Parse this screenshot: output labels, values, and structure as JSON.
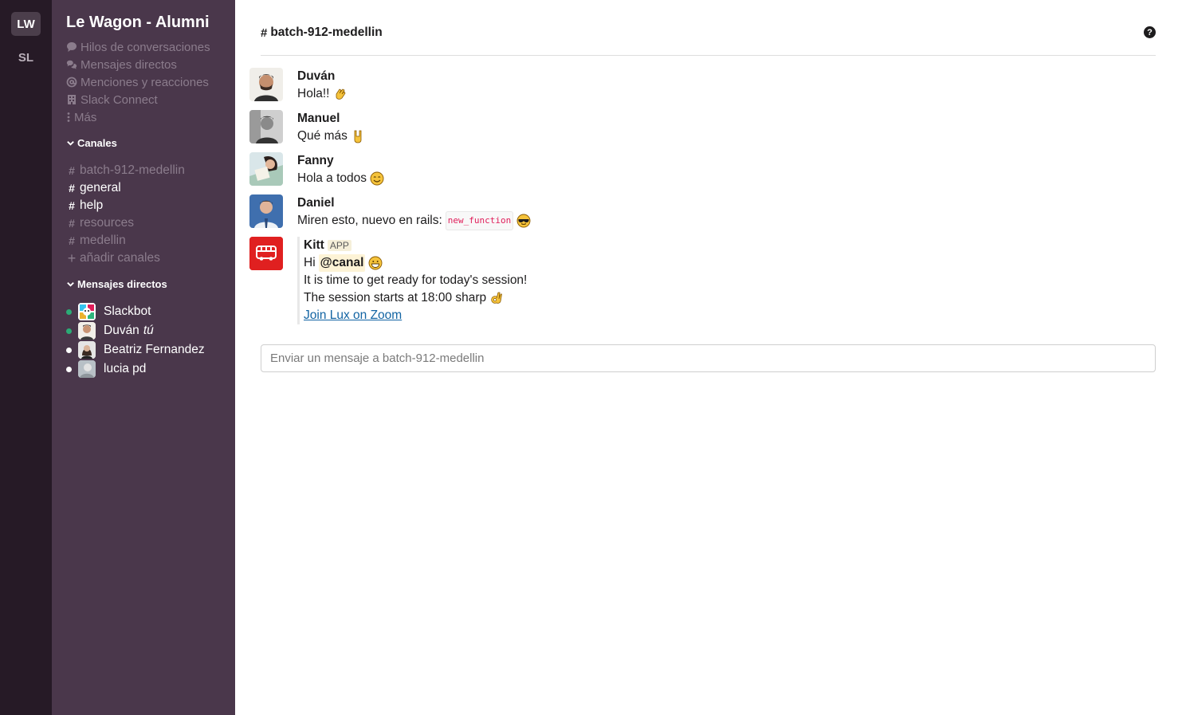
{
  "workspaces": [
    {
      "label": "LW",
      "active": true
    },
    {
      "label": "SL",
      "active": false
    }
  ],
  "sidebar": {
    "team_name": "Le Wagon - Alumni",
    "nav": [
      {
        "label": "Hilos de conversaciones",
        "icon": "threads-icon"
      },
      {
        "label": "Mensajes directos",
        "icon": "direct-messages-icon"
      },
      {
        "label": "Menciones y reacciones",
        "icon": "at-mention-icon"
      },
      {
        "label": "Slack Connect",
        "icon": "building-icon"
      },
      {
        "label": "Más",
        "icon": "more-vertical-icon"
      }
    ],
    "channels_header": "Canales",
    "channels": [
      {
        "name": "batch-912-medellin",
        "bold": false
      },
      {
        "name": "general",
        "bold": true
      },
      {
        "name": "help",
        "bold": true
      },
      {
        "name": "resources",
        "bold": false
      },
      {
        "name": "medellin",
        "bold": false
      }
    ],
    "add_channels": "añadir canales",
    "dms_header": "Mensajes directos",
    "dms": [
      {
        "name": "Slackbot",
        "status": "online",
        "suffix": ""
      },
      {
        "name": "Duván",
        "status": "online",
        "suffix": "tú"
      },
      {
        "name": "Beatriz Fernandez",
        "status": "away",
        "suffix": ""
      },
      {
        "name": "lucia pd",
        "status": "away",
        "suffix": ""
      }
    ]
  },
  "channel": {
    "name": "batch-912-medellin",
    "help_icon": "question-circle-icon"
  },
  "messages": [
    {
      "author": "Duván",
      "text": "Hola!!",
      "emoji": "clapping-hands"
    },
    {
      "author": "Manuel",
      "text": "Qué más",
      "emoji": "rock-hand"
    },
    {
      "author": "Fanny",
      "text": "Hola a todos",
      "emoji": "smiling-face"
    },
    {
      "author": "Daniel",
      "text": "Miren esto, nuevo en rails:",
      "code": "new_function",
      "emoji": "sunglasses-face"
    }
  ],
  "kitt": {
    "author": "Kitt",
    "badge": "APP",
    "greeting": "Hi",
    "mention": "@canal",
    "line2": "It is time to get ready for today's session!",
    "line3": "The session starts at 18:00 sharp",
    "link": "Join Lux on Zoom"
  },
  "composer": {
    "placeholder": "Enviar un mensaje a batch-912-medellin"
  },
  "colors": {
    "rail": "#261a26",
    "sidebar": "#4a374b",
    "kitt_brand": "#e02020",
    "link": "#1264a3",
    "online": "#2bac76"
  }
}
